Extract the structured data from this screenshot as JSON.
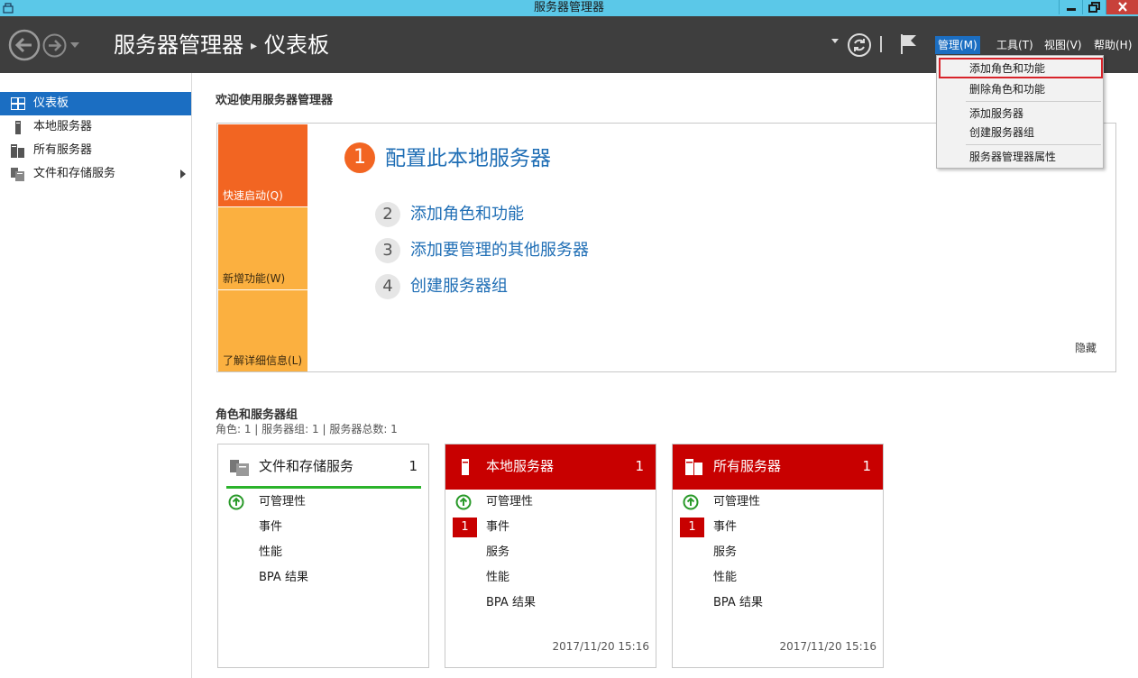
{
  "window": {
    "title": "服务器管理器"
  },
  "header": {
    "breadcrumb_root": "服务器管理器",
    "breadcrumb_sep": "▸",
    "breadcrumb_current": "仪表板",
    "menus": [
      "管理(M)",
      "工具(T)",
      "视图(V)",
      "帮助(H)"
    ]
  },
  "dropdown": {
    "items": [
      "添加角色和功能",
      "删除角色和功能",
      "添加服务器",
      "创建服务器组",
      "服务器管理器属性"
    ]
  },
  "sidebar": {
    "items": [
      {
        "label": "仪表板"
      },
      {
        "label": "本地服务器"
      },
      {
        "label": "所有服务器"
      },
      {
        "label": "文件和存储服务"
      }
    ]
  },
  "welcome": {
    "title": "欢迎使用服务器管理器",
    "tabs": [
      "快速启动(Q)",
      "新增功能(W)",
      "了解详细信息(L)"
    ],
    "steps": [
      {
        "num": "1",
        "label": "配置此本地服务器"
      },
      {
        "num": "2",
        "label": "添加角色和功能"
      },
      {
        "num": "3",
        "label": "添加要管理的其他服务器"
      },
      {
        "num": "4",
        "label": "创建服务器组"
      }
    ],
    "hide": "隐藏"
  },
  "roles": {
    "title": "角色和服务器组",
    "subtitle": "角色: 1 | 服务器组: 1 | 服务器总数: 1",
    "cards": [
      {
        "title": "文件和存储服务",
        "count": "1",
        "rows": [
          "可管理性",
          "事件",
          "性能",
          "BPA 结果"
        ]
      },
      {
        "title": "本地服务器",
        "count": "1",
        "rows": [
          "可管理性",
          "事件",
          "服务",
          "性能",
          "BPA 结果"
        ],
        "event_badge": "1",
        "date": "2017/11/20 15:16"
      },
      {
        "title": "所有服务器",
        "count": "1",
        "rows": [
          "可管理性",
          "事件",
          "服务",
          "性能",
          "BPA 结果"
        ],
        "event_badge": "1",
        "date": "2017/11/20 15:16"
      }
    ]
  },
  "colors": {
    "titlebar": "#5bc8e8",
    "header": "#3e3e3e",
    "accent_blue": "#1b6ec2",
    "orange": "#f26522",
    "light_orange": "#fbb040",
    "alert_red": "#c80000",
    "ok_green": "#2bb32b"
  }
}
